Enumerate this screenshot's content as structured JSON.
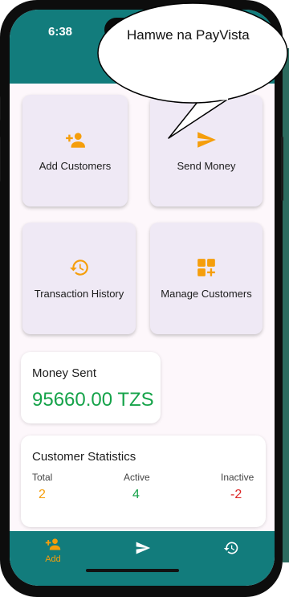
{
  "status_bar": {
    "time": "6:38"
  },
  "speech_bubble": {
    "text": "Hamwe na PayVista"
  },
  "actions": [
    {
      "label": "Add Customers",
      "icon": "person-add-icon"
    },
    {
      "label": "Send Money",
      "icon": "send-icon"
    },
    {
      "label": "Transaction History",
      "icon": "history-icon"
    },
    {
      "label": "Manage Customers",
      "icon": "grid-add-icon"
    }
  ],
  "money_sent": {
    "title": "Money Sent",
    "amount": "95660.00 TZS"
  },
  "stats": {
    "title": "Customer Statistics",
    "total_label": "Total",
    "total_value": "2",
    "active_label": "Active",
    "active_value": "4",
    "inactive_label": "Inactive",
    "inactive_value": "-2"
  },
  "bottom_nav": [
    {
      "label": "Add",
      "icon": "person-add-icon",
      "active": true
    },
    {
      "label": "",
      "icon": "send-icon",
      "active": false
    },
    {
      "label": "",
      "icon": "history-icon",
      "active": false
    }
  ],
  "colors": {
    "primary": "#127c7c",
    "accent": "#f59e0b",
    "green": "#16a34a",
    "red": "#dc2626",
    "card": "#efe9f5"
  }
}
